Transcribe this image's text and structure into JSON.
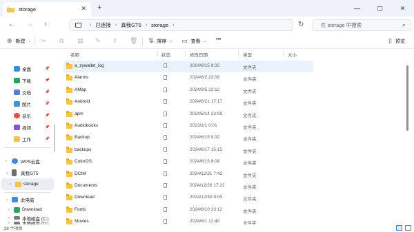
{
  "tab": {
    "title": "storage",
    "close_glyph": "✕",
    "new_glyph": "+"
  },
  "window_controls": {
    "minimize": "—",
    "maximize": "▢",
    "close": "✕"
  },
  "nav": {
    "back": "←",
    "forward": "→",
    "up": "↑",
    "refresh": "↻"
  },
  "breadcrumb": {
    "items": [
      "已连接",
      "真我GT5",
      "storage"
    ],
    "separator": "›",
    "trailing": "›"
  },
  "search": {
    "placeholder": "在 storage 中搜索",
    "icon": "search-icon"
  },
  "toolbar": {
    "new_label": "新建",
    "sort_label": "排序",
    "view_label": "查看",
    "more_label": "•••",
    "preview_label": "预览",
    "icons": [
      "cut-icon",
      "copy-icon",
      "paste-icon",
      "rename-icon",
      "share-icon",
      "delete-icon"
    ]
  },
  "sidebar": {
    "quick": [
      {
        "label": "桌面",
        "color": "#3b8ce0"
      },
      {
        "label": "下载",
        "color": "#2aa160"
      },
      {
        "label": "文档",
        "color": "#4f7fd6"
      },
      {
        "label": "图片",
        "color": "#3a95d8"
      },
      {
        "label": "音乐",
        "color": "#e0533f"
      },
      {
        "label": "视频",
        "color": "#8a4fd6"
      },
      {
        "label": "工作",
        "color": "#f4c34a"
      }
    ],
    "wps_label": "WPS云盘",
    "device_label": "真我GT5",
    "storage_label": "storage",
    "pc_label": "此电脑",
    "download_label": "Download",
    "drive_c_label": "本地磁盘 (C:)",
    "drive_d_label": "本地磁盘 (D:)"
  },
  "columns": {
    "name": "名称",
    "status": "状态",
    "modified": "修改日期",
    "type": "类型",
    "size": "大小"
  },
  "files": [
    {
      "name": "a_zywallet_log",
      "date": "2024/6/15 9:32",
      "type": "文件夹"
    },
    {
      "name": "Alarms",
      "date": "2024/8/2 23:08",
      "type": "文件夹"
    },
    {
      "name": "AMap",
      "date": "2024/9/5 23:12",
      "type": "文件夹"
    },
    {
      "name": "Android",
      "date": "2024/6/21 17:17",
      "type": "文件夹"
    },
    {
      "name": "apm",
      "date": "2024/6/14 23:09",
      "type": "文件夹"
    },
    {
      "name": "Audiobooks",
      "date": "2023/1/1 0:01",
      "type": "文件夹"
    },
    {
      "name": "Backup",
      "date": "2024/6/15 9:32",
      "type": "文件夹"
    },
    {
      "name": "backups",
      "date": "2024/6/17 15:15",
      "type": "文件夹"
    },
    {
      "name": "ColorOS",
      "date": "2024/6/15 8:08",
      "type": "文件夹"
    },
    {
      "name": "DCIM",
      "date": "2024/12/31 7:42",
      "type": "文件夹"
    },
    {
      "name": "Documents",
      "date": "2024/12/26 17:22",
      "type": "文件夹"
    },
    {
      "name": "Download",
      "date": "2024/12/30 9:09",
      "type": "文件夹"
    },
    {
      "name": "Fonts",
      "date": "2024/8/10 23:12",
      "type": "文件夹"
    },
    {
      "name": "Movies",
      "date": "2024/6/1 12:40",
      "type": "文件夹"
    }
  ],
  "status": {
    "count": "28 个项目"
  }
}
